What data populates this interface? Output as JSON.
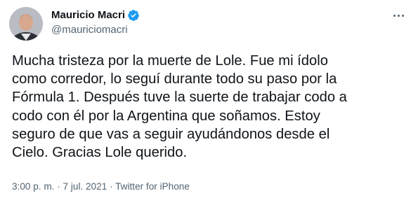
{
  "author": {
    "name": "Mauricio Macri",
    "handle": "@mauriciomacri",
    "verified": true,
    "avatar_icon": "profile-photo",
    "verified_color": "#1d9bf0"
  },
  "menu_icon": "more-horizontal-icon",
  "tweet": {
    "text": "Mucha tristeza por la muerte de Lole. Fue mi ídolo\ncomo corredor, lo seguí durante todo su paso por la\nFórmula 1. Después tuve la suerte de trabajar codo a\ncodo con él por la Argentina que soñamos. Estoy\nseguro de que vas a seguir ayudándonos desde el\nCielo. Gracias Lole querido."
  },
  "meta": {
    "time": "3:00 p. m.",
    "separator": "·",
    "date": "7 jul. 2021",
    "source": "Twitter for iPhone"
  }
}
